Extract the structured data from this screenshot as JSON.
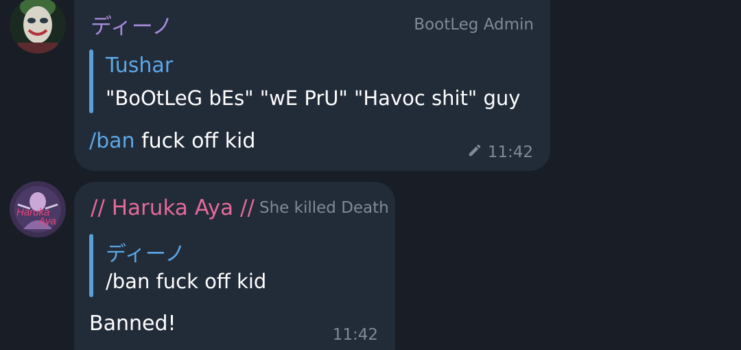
{
  "messages": [
    {
      "sender": "ディーノ",
      "sender_color": "#a78bdb",
      "role": "BootLeg Admin",
      "reply": {
        "name": "Tushar",
        "text": "\"BoOtLeG bEs\" \"wE PrU\" \"Havoc shit\" guy"
      },
      "command": "/ban",
      "text": " fuck off kid",
      "edited_icon": "pencil-icon",
      "time": "11:42",
      "avatar": "joker-avatar"
    },
    {
      "sender": "// Haruka Aya //",
      "sender_color": "#e56a9a",
      "role": "She killed Death",
      "reply": {
        "name": "ディーノ",
        "text": "/ban fuck off kid"
      },
      "text": "Banned!",
      "time": "11:42",
      "avatar": "haruka-aya-avatar",
      "avatar_text_line1": "Haruka",
      "avatar_text_line2": "Aya"
    }
  ],
  "colors": {
    "background": "#181d26",
    "bubble": "#222b38",
    "link": "#5ea8e6",
    "muted": "#7f8b99"
  }
}
